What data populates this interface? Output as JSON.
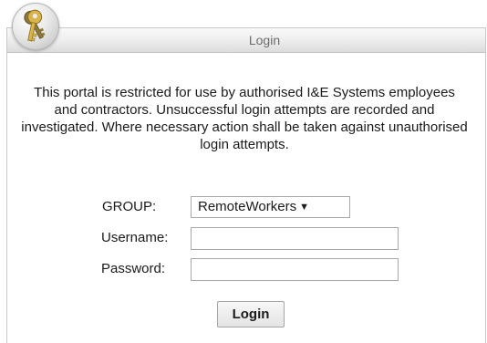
{
  "panel": {
    "title": "Login",
    "icon": "keys-icon"
  },
  "notice": {
    "text": "This portal is restricted for use by authorised I&E Systems employees and contractors. Unsuccessful login attempts are recorded and investigated. Where necessary action shall be taken against unauthorised login attempts."
  },
  "form": {
    "group_label": "GROUP:",
    "group_selected": "RemoteWorkers",
    "username_label": "Username:",
    "username_value": "",
    "password_label": "Password:",
    "password_value": "",
    "submit_label": "Login"
  },
  "colors": {
    "title_text": "#6b6b6b",
    "panel_border": "#c9c9c9",
    "body_text": "#1a1a1a"
  }
}
